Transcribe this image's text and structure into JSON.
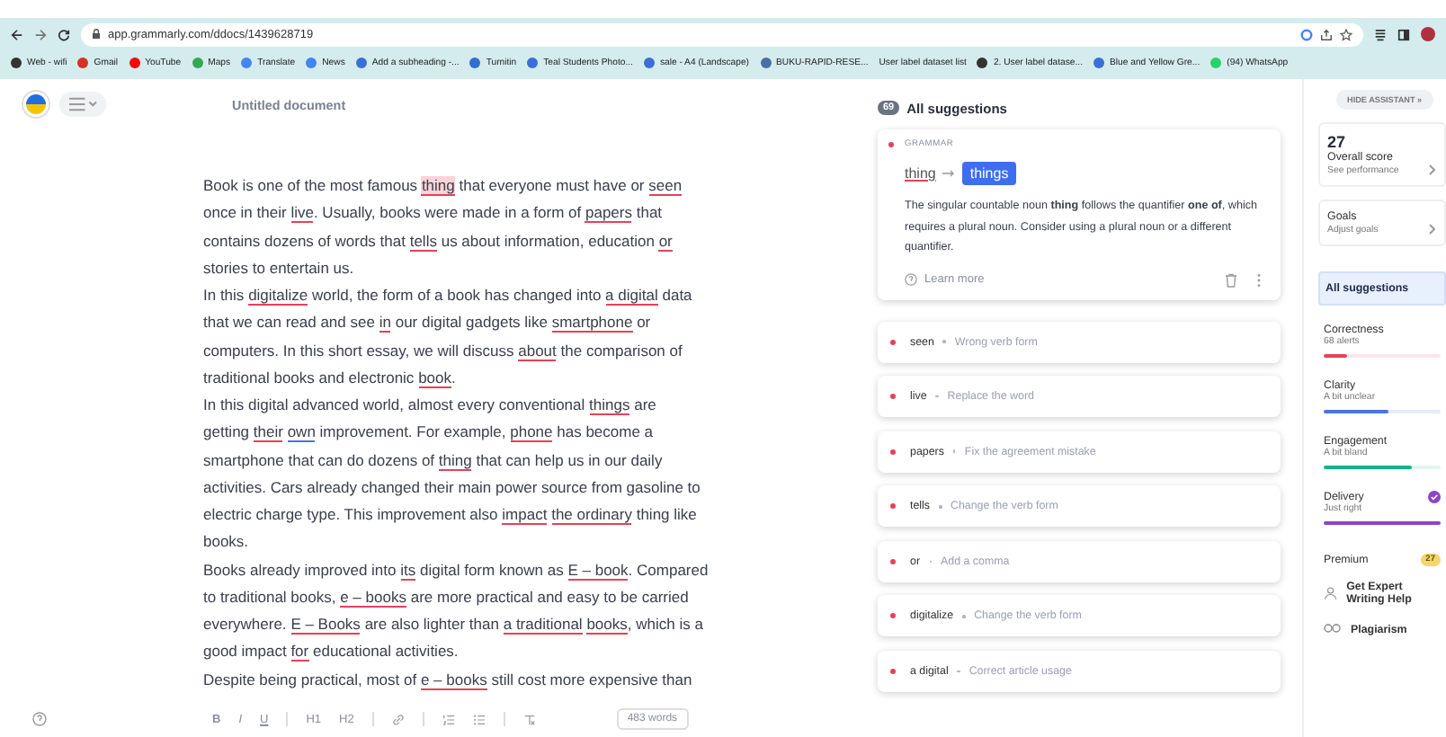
{
  "browser": {
    "url": "app.grammarly.com/ddocs/1439628719",
    "bookmarks": [
      {
        "label": "Web - wifi",
        "color": "#333333"
      },
      {
        "label": "Gmail",
        "color": "#d93025"
      },
      {
        "label": "YouTube",
        "color": "#ff0000"
      },
      {
        "label": "Maps",
        "color": "#34a853"
      },
      {
        "label": "Translate",
        "color": "#4285f4"
      },
      {
        "label": "News",
        "color": "#4285f4"
      },
      {
        "label": "Add a subheading -...",
        "color": "#3b6fd8"
      },
      {
        "label": "Turnitin",
        "color": "#2f6fd0"
      },
      {
        "label": "Teal Students Photo...",
        "color": "#3b6fd8"
      },
      {
        "label": "sale - A4 (Landscape)",
        "color": "#3b6fd8"
      },
      {
        "label": "BUKU-RAPID-RESE...",
        "color": "#4a6fa5"
      },
      {
        "label": "User label dataset list"
      },
      {
        "label": "2. User label datase...",
        "color": "#333333"
      },
      {
        "label": "Blue and Yellow Gre...",
        "color": "#3b6fd8"
      },
      {
        "label": "(94) WhatsApp",
        "color": "#25d366"
      }
    ]
  },
  "editor": {
    "title": "Untitled document",
    "lines": [
      {
        "segments": [
          {
            "text": "Book is one of the most famous ",
            "kind": "plain"
          },
          {
            "text": "thing",
            "kind": "active"
          },
          {
            "text": " that everyone must have or ",
            "kind": "plain"
          },
          {
            "text": "seen",
            "kind": "error"
          }
        ]
      },
      {
        "segments": [
          {
            "text": "once in their ",
            "kind": "plain"
          },
          {
            "text": "live",
            "kind": "error"
          },
          {
            "text": ". Usually, books were made in a form of ",
            "kind": "plain"
          },
          {
            "text": "papers",
            "kind": "error"
          },
          {
            "text": " that",
            "kind": "plain"
          }
        ]
      },
      {
        "segments": [
          {
            "text": "contains dozens of words that ",
            "kind": "plain"
          },
          {
            "text": "tells",
            "kind": "error"
          },
          {
            "text": " us about information, education ",
            "kind": "plain"
          },
          {
            "text": "or",
            "kind": "error"
          }
        ]
      },
      {
        "segments": [
          {
            "text": "stories to entertain us.",
            "kind": "plain"
          }
        ]
      },
      {
        "segments": [
          {
            "text": "In this ",
            "kind": "plain"
          },
          {
            "text": "digitalize",
            "kind": "error"
          },
          {
            "text": " world, the form of a book has changed into ",
            "kind": "plain"
          },
          {
            "text": "a digital",
            "kind": "error"
          },
          {
            "text": " data",
            "kind": "plain"
          }
        ]
      },
      {
        "segments": [
          {
            "text": "that we can read and see ",
            "kind": "plain"
          },
          {
            "text": "in",
            "kind": "error"
          },
          {
            "text": " our digital gadgets like ",
            "kind": "plain"
          },
          {
            "text": "smartphone",
            "kind": "error"
          },
          {
            "text": " or",
            "kind": "plain"
          }
        ]
      },
      {
        "segments": [
          {
            "text": "computers. In this short essay, we will discuss ",
            "kind": "plain"
          },
          {
            "text": "about",
            "kind": "error"
          },
          {
            "text": " the comparison of",
            "kind": "plain"
          }
        ]
      },
      {
        "segments": [
          {
            "text": "traditional books and electronic ",
            "kind": "plain"
          },
          {
            "text": "book",
            "kind": "error"
          },
          {
            "text": ".",
            "kind": "plain"
          }
        ]
      },
      {
        "segments": [
          {
            "text": "In this digital advanced world, almost every conventional ",
            "kind": "plain"
          },
          {
            "text": "things",
            "kind": "error"
          },
          {
            "text": " are",
            "kind": "plain"
          }
        ]
      },
      {
        "segments": [
          {
            "text": "getting ",
            "kind": "plain"
          },
          {
            "text": "their",
            "kind": "error"
          },
          {
            "text": " own",
            "kind": "clarity"
          },
          {
            "text": " improvement. For example, ",
            "kind": "plain"
          },
          {
            "text": "phone",
            "kind": "error"
          },
          {
            "text": " has become a",
            "kind": "plain"
          }
        ]
      },
      {
        "segments": [
          {
            "text": "smartphone that can do dozens of ",
            "kind": "plain"
          },
          {
            "text": "thing",
            "kind": "error"
          },
          {
            "text": " that can help us in our daily",
            "kind": "plain"
          }
        ]
      },
      {
        "segments": [
          {
            "text": "activities. Cars already changed their main power source from gasoline to",
            "kind": "plain"
          }
        ]
      },
      {
        "segments": [
          {
            "text": "electric charge type. This improvement also ",
            "kind": "plain"
          },
          {
            "text": "impact",
            "kind": "error"
          },
          {
            "text": " the ordinary",
            "kind": "error"
          },
          {
            "text": " thing like",
            "kind": "plain"
          }
        ]
      },
      {
        "segments": [
          {
            "text": "books.",
            "kind": "plain"
          }
        ]
      },
      {
        "segments": [
          {
            "text": "Books already improved into ",
            "kind": "plain"
          },
          {
            "text": "its",
            "kind": "error"
          },
          {
            "text": " digital form known as ",
            "kind": "plain"
          },
          {
            "text": "E – book",
            "kind": "error"
          },
          {
            "text": ". Compared",
            "kind": "plain"
          }
        ]
      },
      {
        "segments": [
          {
            "text": "to traditional books, ",
            "kind": "plain"
          },
          {
            "text": "e – books",
            "kind": "error"
          },
          {
            "text": " are more practical and easy to be carried",
            "kind": "plain"
          }
        ]
      },
      {
        "segments": [
          {
            "text": "everywhere. ",
            "kind": "plain"
          },
          {
            "text": "E – Books",
            "kind": "error"
          },
          {
            "text": " are also lighter than ",
            "kind": "plain"
          },
          {
            "text": "a traditional",
            "kind": "error"
          },
          {
            "text": " books",
            "kind": "error"
          },
          {
            "text": ", which is a",
            "kind": "plain"
          }
        ]
      },
      {
        "segments": [
          {
            "text": "good impact ",
            "kind": "plain"
          },
          {
            "text": "for",
            "kind": "error"
          },
          {
            "text": " educational activities.",
            "kind": "plain"
          }
        ]
      },
      {
        "segments": [
          {
            "text": "Despite being practical, most of ",
            "kind": "plain"
          },
          {
            "text": "e – books",
            "kind": "error"
          },
          {
            "text": " still cost more expensive than",
            "kind": "plain"
          }
        ]
      }
    ],
    "format_buttons": [
      "B",
      "I",
      "U",
      "H1",
      "H2"
    ],
    "word_count": "483 words"
  },
  "assistant": {
    "count": "69",
    "title": "All suggestions",
    "card": {
      "category": "GRAMMAR",
      "original": "thing",
      "replacement": "things",
      "explanation": "The singular countable noun **thing** follows the quantifier **one of**, which requires a plural noun. Consider using a plural noun or a different quantifier.",
      "learn_more": "Learn more"
    },
    "items": [
      {
        "word": "seen",
        "description": "Wrong verb form"
      },
      {
        "word": "live",
        "description": "Replace the word"
      },
      {
        "word": "papers",
        "description": "Fix the agreement mistake"
      },
      {
        "word": "tells",
        "description": "Change the verb form"
      },
      {
        "word": "or",
        "description": "Add a comma"
      },
      {
        "word": "digitalize",
        "description": "Change the verb form"
      },
      {
        "word": "a digital",
        "description": "Correct article usage"
      }
    ]
  },
  "sidebar": {
    "hide_button": "HIDE ASSISTANT »",
    "score": "27",
    "score_label": "Overall score",
    "score_link": "See performance",
    "goals": "Goals",
    "goals_link": "Adjust goals",
    "nav": {
      "label": "All suggestions",
      "selected": true
    },
    "categories": [
      {
        "name": "Correctness",
        "status": "68 alerts",
        "level": 0.2,
        "color": "#e5425a",
        "checked": false
      },
      {
        "name": "Clarity",
        "status": "A bit unclear",
        "level": 0.55,
        "color": "#4a74e0",
        "checked": false
      },
      {
        "name": "Engagement",
        "status": "A bit bland",
        "level": 0.75,
        "color": "#15b28a",
        "checked": false
      },
      {
        "name": "Delivery",
        "status": "Just right",
        "level": 1,
        "color": "#8e44c8",
        "checked": true
      }
    ],
    "premium": "Premium",
    "premium_count": "27",
    "expert": "Get Expert Writing Help",
    "plagiarism": "Plagiarism"
  }
}
